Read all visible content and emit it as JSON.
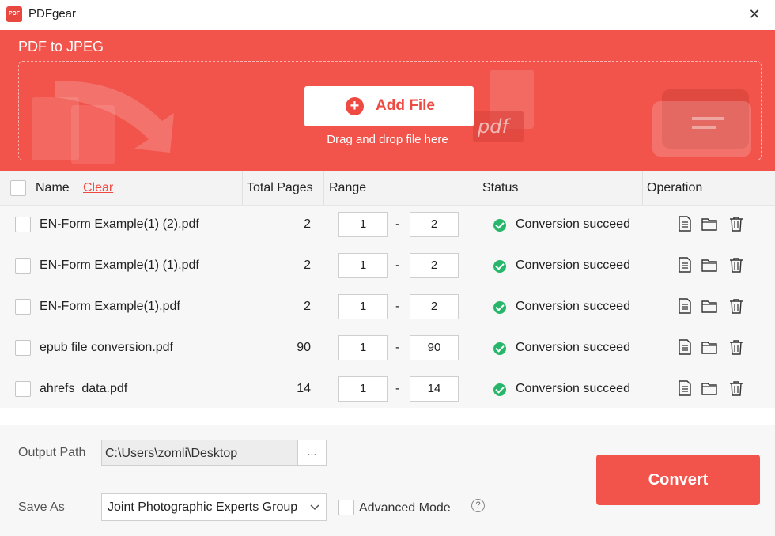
{
  "window": {
    "app_title": "PDFgear",
    "logo_text": "PDF",
    "close_glyph": "✕"
  },
  "header": {
    "title": "PDF to JPEG",
    "add_file_label": "Add File",
    "drop_hint": "Drag and drop file here",
    "decor_text": "pdf"
  },
  "table": {
    "columns": {
      "name": "Name",
      "clear": "Clear",
      "total_pages": "Total Pages",
      "range": "Range",
      "status": "Status",
      "operation": "Operation"
    },
    "range_separator": "-",
    "rows": [
      {
        "name": "EN-Form Example(1) (2).pdf",
        "pages": "2",
        "from": "1",
        "to": "2",
        "status": "Conversion succeed"
      },
      {
        "name": "EN-Form Example(1) (1).pdf",
        "pages": "2",
        "from": "1",
        "to": "2",
        "status": "Conversion succeed"
      },
      {
        "name": "EN-Form Example(1).pdf",
        "pages": "2",
        "from": "1",
        "to": "2",
        "status": "Conversion succeed"
      },
      {
        "name": "epub file conversion.pdf",
        "pages": "90",
        "from": "1",
        "to": "90",
        "status": "Conversion succeed"
      },
      {
        "name": "ahrefs_data.pdf",
        "pages": "14",
        "from": "1",
        "to": "14",
        "status": "Conversion succeed"
      }
    ]
  },
  "footer": {
    "output_path_label": "Output Path",
    "output_path": "C:\\Users\\zomli\\Desktop",
    "browse_label": "...",
    "save_as_label": "Save As",
    "save_as_value": "Joint Photographic Experts Group",
    "advanced_mode_label": "Advanced Mode",
    "help_glyph": "?",
    "convert_label": "Convert"
  },
  "colors": {
    "accent": "#f2544c",
    "success": "#27b66a"
  }
}
